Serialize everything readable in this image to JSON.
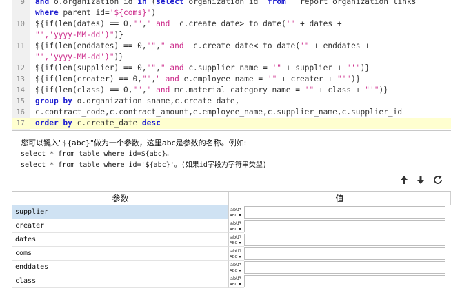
{
  "editor": {
    "lines": [
      {
        "num": "9",
        "segs": [
          [
            "kw",
            "and "
          ],
          [
            "t",
            "o.organization_id "
          ],
          [
            "kw",
            "in "
          ],
          [
            "t",
            "("
          ],
          [
            "kw",
            "select "
          ],
          [
            "t",
            "organization_id  "
          ],
          [
            "kw",
            "from "
          ],
          [
            "t",
            "  report_organization_links"
          ]
        ]
      },
      {
        "num": "",
        "segs": [
          [
            "kw",
            "where "
          ],
          [
            "t",
            "parent_id="
          ],
          [
            "str",
            "'${coms}'"
          ],
          [
            "t",
            ")"
          ]
        ]
      },
      {
        "num": "10",
        "segs": [
          [
            "t",
            "${if(len(dates) == 0,"
          ],
          [
            "str",
            "\"\""
          ],
          [
            "t",
            ","
          ],
          [
            "str",
            "\" and  "
          ],
          [
            "t",
            "c.create_date> to_date("
          ],
          [
            "str",
            "'\""
          ],
          [
            "t",
            " + dates + "
          ]
        ]
      },
      {
        "num": "",
        "segs": [
          [
            "str",
            "\"','yyyy-MM-dd')\""
          ],
          [
            "t",
            ")}"
          ]
        ]
      },
      {
        "num": "11",
        "segs": [
          [
            "t",
            "${if(len(enddates) == 0,"
          ],
          [
            "str",
            "\"\""
          ],
          [
            "t",
            ","
          ],
          [
            "str",
            "\" and  "
          ],
          [
            "t",
            "c.create_date< to_date("
          ],
          [
            "str",
            "'\""
          ],
          [
            "t",
            " + enddates +"
          ]
        ]
      },
      {
        "num": "",
        "segs": [
          [
            "str",
            "\"','yyyy-MM-dd')\""
          ],
          [
            "t",
            ")}"
          ]
        ]
      },
      {
        "num": "12",
        "segs": [
          [
            "t",
            "${if(len(supplier) == 0,"
          ],
          [
            "str",
            "\"\""
          ],
          [
            "t",
            ","
          ],
          [
            "str",
            "\" and "
          ],
          [
            "t",
            "c.supplier_name = "
          ],
          [
            "str",
            "'\""
          ],
          [
            "t",
            " + supplier + "
          ],
          [
            "str",
            "\"'\""
          ],
          [
            "t",
            ")}"
          ]
        ]
      },
      {
        "num": "13",
        "segs": [
          [
            "t",
            "${if(len(creater) == 0,"
          ],
          [
            "str",
            "\"\""
          ],
          [
            "t",
            ","
          ],
          [
            "str",
            "\" and "
          ],
          [
            "t",
            "e.employee_name = "
          ],
          [
            "str",
            "'\""
          ],
          [
            "t",
            " + creater + "
          ],
          [
            "str",
            "\"'\""
          ],
          [
            "t",
            ")}"
          ]
        ]
      },
      {
        "num": "14",
        "segs": [
          [
            "t",
            "${if(len(class) == 0,"
          ],
          [
            "str",
            "\"\""
          ],
          [
            "t",
            ","
          ],
          [
            "str",
            "\" and "
          ],
          [
            "t",
            "mc.material_category_name = "
          ],
          [
            "str",
            "'\""
          ],
          [
            "t",
            " + class + "
          ],
          [
            "str",
            "\"'\""
          ],
          [
            "t",
            ")}"
          ]
        ]
      },
      {
        "num": "15",
        "segs": [
          [
            "kw",
            "group by "
          ],
          [
            "t",
            "o.organization_sname,c.create_date,"
          ]
        ]
      },
      {
        "num": "16",
        "segs": [
          [
            "t",
            "c.contract_code,c.contract_amount,e.employee_name,c.supplier_name,c.supplier_id"
          ]
        ]
      },
      {
        "num": "17",
        "segs": [
          [
            "kw",
            "order by "
          ],
          [
            "t",
            "c.create_date "
          ],
          [
            "kw",
            "desc"
          ]
        ],
        "active": true
      }
    ]
  },
  "hint": {
    "line1": "您可以键入\"${abc}\"做为一个参数，这里abc是参数的名称。例如:",
    "line2": "select * from table where id=${abc}。",
    "line3": "select * from table where id='${abc}'。(如果id字段为字符串类型)"
  },
  "toolbar": {
    "up_icon": "arrow-up-icon",
    "down_icon": "arrow-down-icon",
    "refresh_icon": "refresh-icon"
  },
  "grid": {
    "col_param": "参数",
    "col_value": "值",
    "type_icon": "abc-type-icon",
    "rows": [
      {
        "name": "supplier",
        "value": "",
        "selected": true
      },
      {
        "name": "creater",
        "value": ""
      },
      {
        "name": "dates",
        "value": ""
      },
      {
        "name": "coms",
        "value": ""
      },
      {
        "name": "enddates",
        "value": ""
      },
      {
        "name": "class",
        "value": ""
      }
    ]
  },
  "colors": {
    "keyword": "#1f1fd0",
    "string": "#cc2a8a",
    "active_line": "#ffffd0",
    "selected_row": "#cfe2f3"
  }
}
